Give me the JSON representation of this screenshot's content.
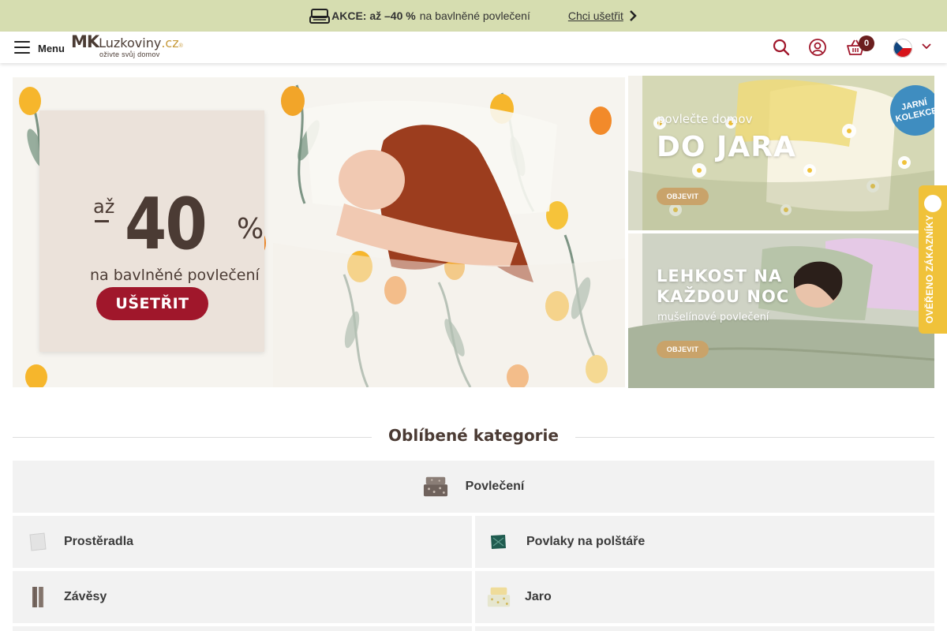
{
  "promo_bar": {
    "strong_text": "AKCE: až –40 %",
    "rest_text": "na bavlněné povlečení",
    "link_text": "Chci ušetřit"
  },
  "header": {
    "menu_label": "Menu",
    "logo": {
      "mk": "MK",
      "name": "Luzkoviny",
      "tld": ".cz",
      "reg": "®",
      "tagline": "oživte svůj domov"
    },
    "cart_count": "0",
    "icons": [
      "search-icon",
      "user-icon",
      "basket-icon",
      "czech-flag-icon",
      "chevron-down-icon"
    ]
  },
  "hero": {
    "main": {
      "az": "až",
      "number": "40",
      "percent": "%",
      "subtitle": "na bavlněné povlečení",
      "button": "UŠETŘIT"
    },
    "side_top": {
      "small": "povlečte domov",
      "big": "DO JARA",
      "button": "OBJEVIT",
      "badge_line1": "JARNÍ",
      "badge_line2": "KOLEKCE"
    },
    "side_bottom": {
      "big_line1": "LEHKOST NA",
      "big_line2": "KAŽDOU NOC",
      "small": "mušelínové povlečení",
      "button": "OBJEVIT"
    }
  },
  "verified_tab": {
    "label": "OVĚŘENO ZÁKAZNÍKY"
  },
  "categories": {
    "heading": "Oblíbené kategorie",
    "featured": "Povlečení",
    "items": [
      {
        "label": "Prostěradla"
      },
      {
        "label": "Povlaky na polštáře"
      },
      {
        "label": "Závěsy"
      },
      {
        "label": "Jaro"
      }
    ]
  },
  "colors": {
    "promo_bar_bg": "#d6ddb0",
    "brand_brown": "#4b3b34",
    "cta_red": "#a0172b",
    "cart_badge": "#6b1f1f",
    "verified_yellow": "#f0c23a",
    "objevit_gold": "#c9a36a"
  }
}
